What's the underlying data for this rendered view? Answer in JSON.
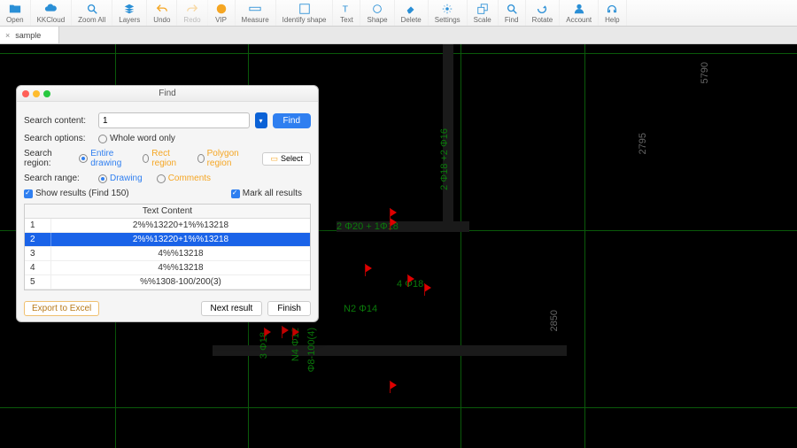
{
  "toolbar": {
    "items": [
      {
        "label": "Open"
      },
      {
        "label": "KKCloud"
      },
      {
        "label": "Zoom All"
      },
      {
        "label": "Layers"
      },
      {
        "label": "Undo"
      },
      {
        "label": "Redo"
      },
      {
        "label": "VIP"
      },
      {
        "label": "Measure"
      },
      {
        "label": "Identify shape"
      },
      {
        "label": "Text"
      },
      {
        "label": "Shape"
      },
      {
        "label": "Delete"
      },
      {
        "label": "Settings"
      },
      {
        "label": "Scale"
      },
      {
        "label": "Find"
      },
      {
        "label": "Rotate"
      },
      {
        "label": "Account"
      },
      {
        "label": "Help"
      }
    ]
  },
  "tab": {
    "name": "sample",
    "close": "×"
  },
  "dialog": {
    "title": "Find",
    "search_content_label": "Search content:",
    "search_content_value": "1",
    "find_btn": "Find",
    "search_options_label": "Search options:",
    "whole_word": "Whole word only",
    "search_region_label": "Search region:",
    "entire_drawing": "Entire drawing",
    "rect_region": "Rect region",
    "polygon_region": "Polygon region",
    "select_btn": "Select",
    "search_range_label": "Search range:",
    "drawing": "Drawing",
    "comments": "Comments",
    "show_results": "Show results (Find 150)",
    "mark_all": "Mark all results",
    "table_header": "Text Content",
    "rows": [
      {
        "n": "1",
        "t": "2%%13220+1%%13218"
      },
      {
        "n": "2",
        "t": "2%%13220+1%%13218"
      },
      {
        "n": "3",
        "t": "4%%13218"
      },
      {
        "n": "4",
        "t": "4%%13218"
      },
      {
        "n": "5",
        "t": "%%1308-100/200(3)"
      }
    ],
    "export": "Export to Excel",
    "next": "Next result",
    "finish": "Finish"
  },
  "cad": {
    "t1": "2 Φ20 + 1Φ18",
    "t2": "4 Φ18",
    "t3": "N2 Φ14",
    "t4": "2 Φ18 +2 Φ16",
    "t5": "N4 Φ12",
    "t6": "3 Φ18",
    "t7": "Φ8-100(4)",
    "d1": "5790",
    "d2": "2795",
    "d3": "2850"
  }
}
